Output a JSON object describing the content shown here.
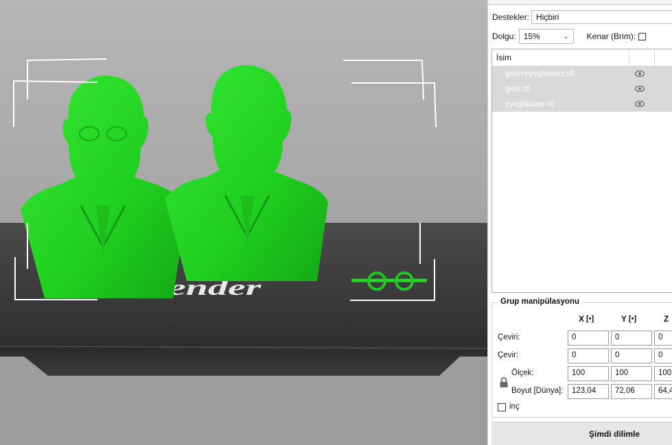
{
  "settings": {
    "supports_label": "Destekler:",
    "supports_value": "Hiçbiri",
    "infill_label": "Dolgu:",
    "infill_value": "15%",
    "brim_label": "Kenar (Brim):"
  },
  "object_list": {
    "header_name": "İsim",
    "items": [
      {
        "name": "gide+eyeglasses.stl"
      },
      {
        "name": "gide.stl"
      },
      {
        "name": "eyeglasses.stl"
      }
    ]
  },
  "group_manipulation": {
    "title": "Grup manipülasyonu",
    "axes": [
      "X",
      "Y",
      "Z"
    ],
    "translate_label": "Çeviri:",
    "translate": [
      "0",
      "0",
      "0"
    ],
    "rotate_label": "Çevir:",
    "rotate": [
      "0",
      "0",
      "0"
    ],
    "scale_label": "Ölçek:",
    "scale": [
      "100",
      "100",
      "100"
    ],
    "size_label": "Boyut [Dünya]:",
    "size": [
      "123,04",
      "72,06",
      "64,4"
    ],
    "inch_label": "inç"
  },
  "slice_button": "Şimdi dilimle",
  "bed_logo_text": "ender",
  "colors": {
    "model_green": "#22d622",
    "bed_dark": "#333333",
    "selection_bg": "#d9d9d9"
  }
}
